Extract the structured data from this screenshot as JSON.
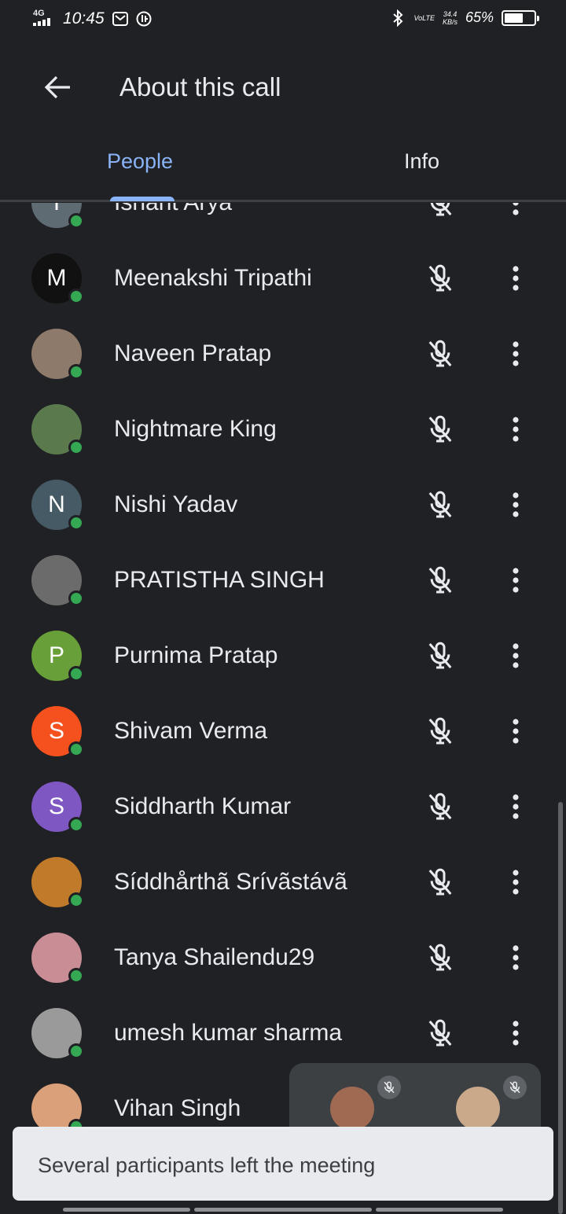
{
  "status_bar": {
    "network": "4G",
    "time": "10:45",
    "speed_value": "34.4",
    "speed_unit": "KB/s",
    "volte": "VoLTE",
    "battery": "65%",
    "battery_level": 0.65
  },
  "header": {
    "title": "About this call"
  },
  "tabs": [
    {
      "label": "People",
      "selected": true
    },
    {
      "label": "Info",
      "selected": false
    }
  ],
  "participants": [
    {
      "name": "Ishant Arya",
      "initial": "I",
      "avatar_color": "#5f6b73"
    },
    {
      "name": "Meenakshi Tripathi",
      "initial": "M",
      "avatar_color": "#111111"
    },
    {
      "name": "Naveen Pratap",
      "initial": "",
      "avatar_color": "#8d7a6a"
    },
    {
      "name": "Nightmare King",
      "initial": "",
      "avatar_color": "#5a7a4d"
    },
    {
      "name": "Nishi Yadav",
      "initial": "N",
      "avatar_color": "#455a64"
    },
    {
      "name": "PRATISTHA SINGH",
      "initial": "",
      "avatar_color": "#6b6b6b"
    },
    {
      "name": "Purnima Pratap",
      "initial": "P",
      "avatar_color": "#689f38"
    },
    {
      "name": "Shivam Verma",
      "initial": "S",
      "avatar_color": "#f4511e"
    },
    {
      "name": "Siddharth Kumar",
      "initial": "S",
      "avatar_color": "#7e57c2"
    },
    {
      "name": "Síddhårthã Srívãstávã",
      "initial": "",
      "avatar_color": "#c07a2a"
    },
    {
      "name": "Tanya Shailendu29",
      "initial": "",
      "avatar_color": "#c98d96"
    },
    {
      "name": "umesh kumar sharma",
      "initial": "",
      "avatar_color": "#9a9a9a"
    },
    {
      "name": "Vihan Singh",
      "initial": "",
      "avatar_color": "#d9a07a"
    }
  ],
  "toast": {
    "message": "Several participants left the meeting"
  },
  "colors": {
    "background": "#202124",
    "accent": "#8ab4f8",
    "presence": "#34a853"
  }
}
